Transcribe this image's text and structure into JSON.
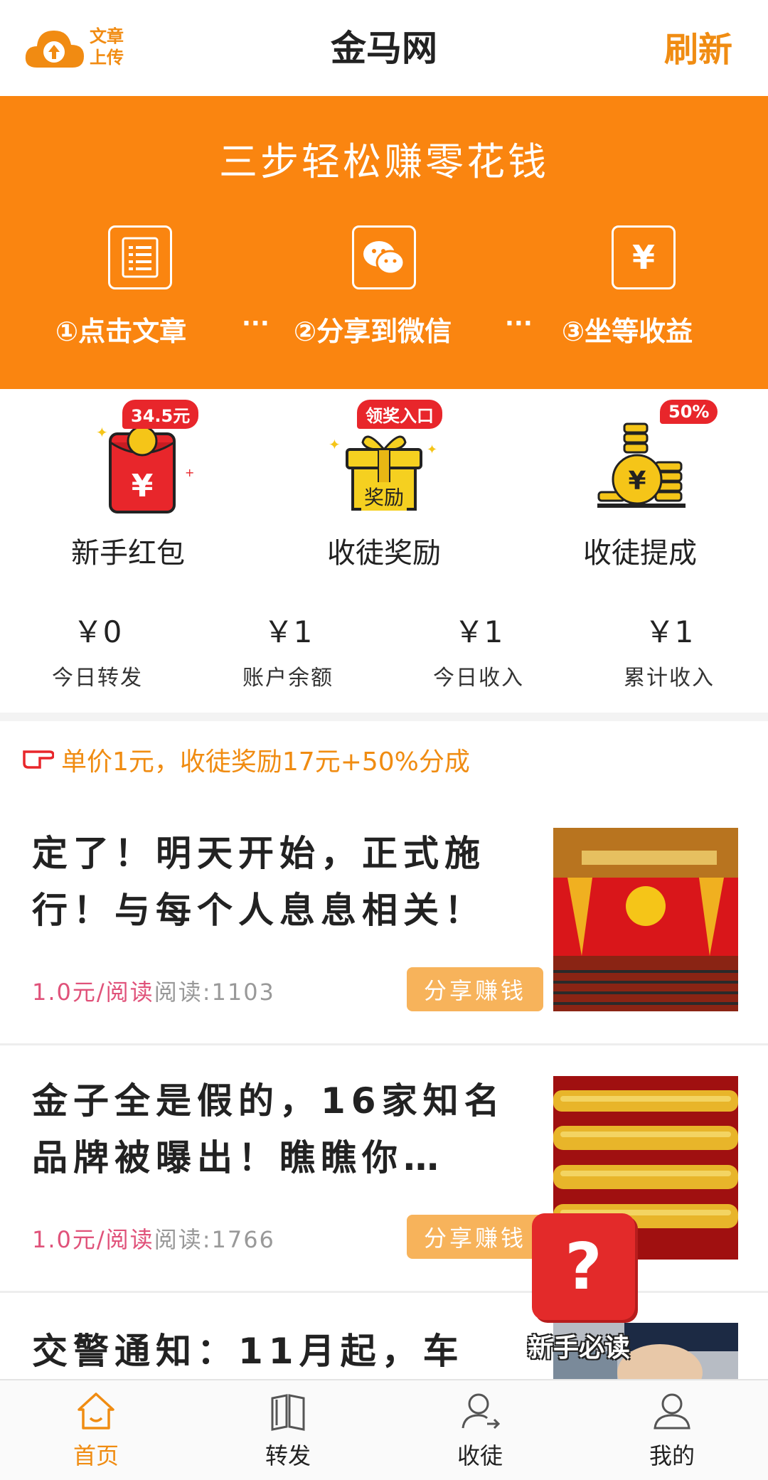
{
  "header": {
    "upload_label_line1": "文章",
    "upload_label_line2": "上传",
    "title": "金马网",
    "refresh_label": "刷新"
  },
  "banner": {
    "title": "三步轻松赚零花钱",
    "steps": [
      {
        "label": "①点击文章",
        "icon": "document-icon"
      },
      {
        "label": "②分享到微信",
        "icon": "wechat-icon"
      },
      {
        "label": "③坐等收益",
        "icon": "yen-icon"
      }
    ],
    "separator": "···"
  },
  "features": [
    {
      "label": "新手红包",
      "badge": "34.5元",
      "icon": "red-envelope-icon"
    },
    {
      "label": "收徒奖励",
      "badge": "领奖入口",
      "icon": "gift-box-icon",
      "icon_text": "奖励"
    },
    {
      "label": "收徒提成",
      "badge": "50%",
      "icon": "coin-stack-icon"
    }
  ],
  "stats": [
    {
      "value": "￥0",
      "label": "今日转发"
    },
    {
      "value": "￥1",
      "label": "账户余额"
    },
    {
      "value": "￥1",
      "label": "今日收入"
    },
    {
      "value": "￥1",
      "label": "累计收入"
    }
  ],
  "promo": {
    "text": "单价1元，收徒奖励17元+50%分成"
  },
  "articles": [
    {
      "title": "定了！明天开始，正式施行！与每个人息息相关！",
      "price": "1.0元/阅读",
      "reads": "阅读:1103",
      "share_label": "分享赚钱"
    },
    {
      "title": "金子全是假的，16家知名品牌被曝出！瞧瞧你…",
      "price": "1.0元/阅读",
      "reads": "阅读:1766",
      "share_label": "分享赚钱"
    },
    {
      "title": "交警通知：11月起，车"
    }
  ],
  "help": {
    "label": "新手必读"
  },
  "nav": [
    {
      "label": "首页",
      "icon": "home-icon",
      "active": true
    },
    {
      "label": "转发",
      "icon": "book-icon",
      "active": false
    },
    {
      "label": "收徒",
      "icon": "add-user-icon",
      "active": false
    },
    {
      "label": "我的",
      "icon": "user-icon",
      "active": false
    }
  ],
  "colors": {
    "brand_orange": "#fa8510",
    "accent_orange": "#f08c12",
    "badge_red": "#e8262b",
    "price_pink": "#e0527a",
    "share_button": "#f7b35b"
  }
}
